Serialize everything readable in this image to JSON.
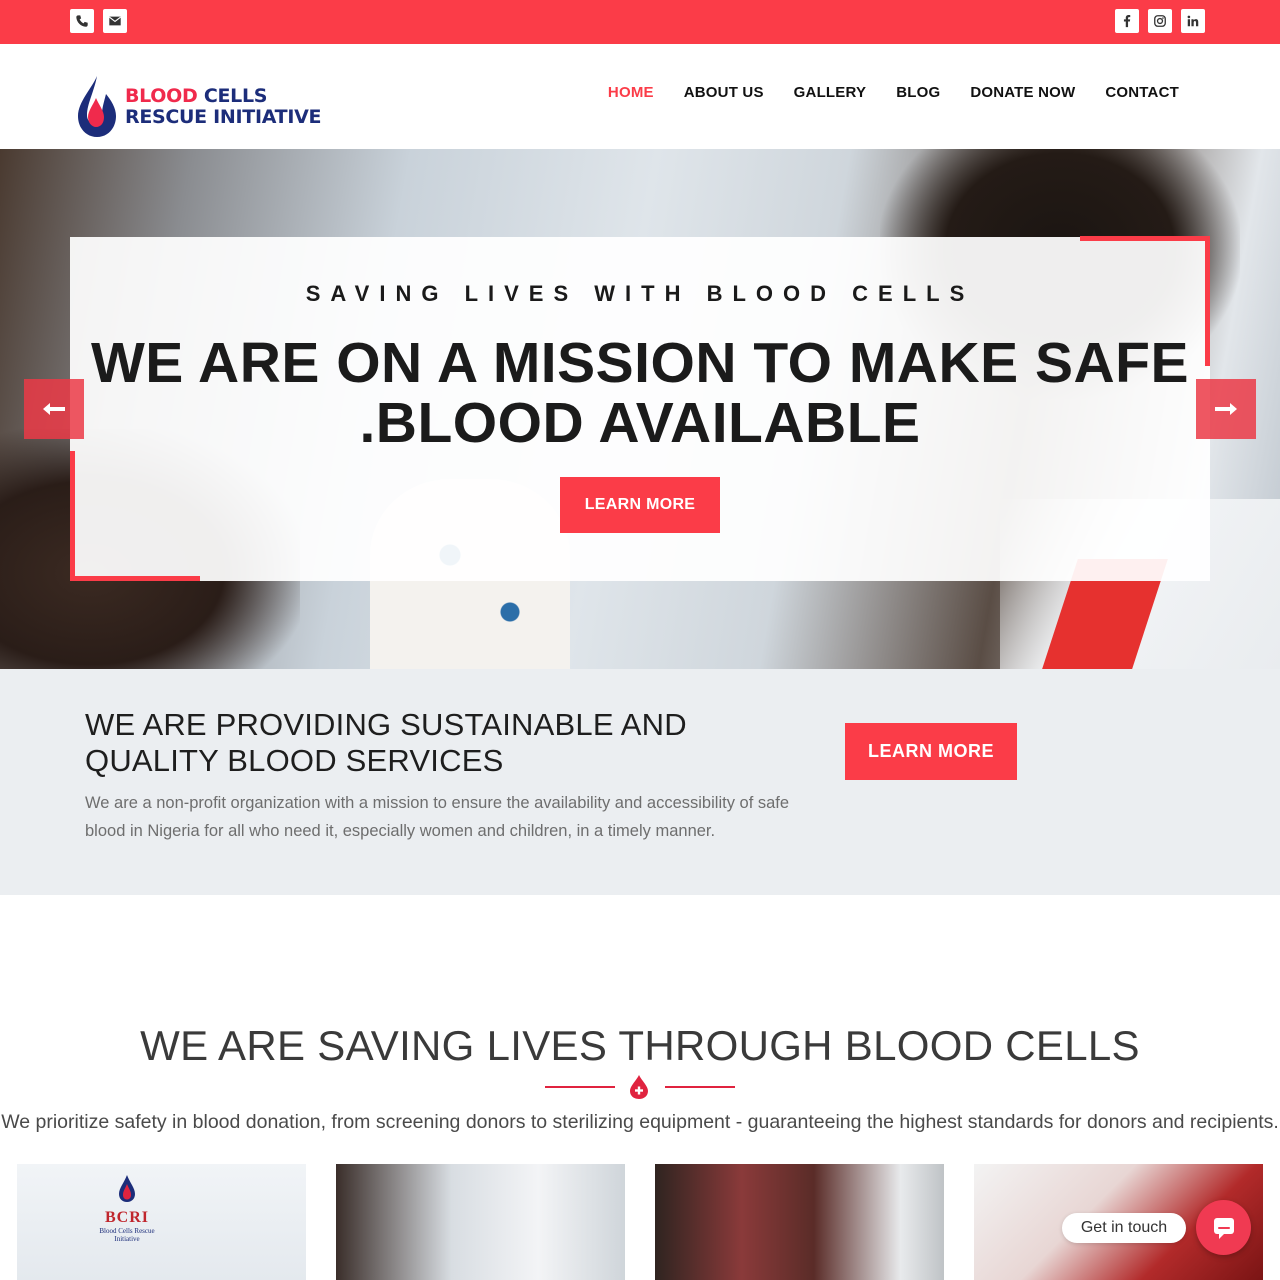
{
  "topbar": {
    "left_icons": [
      "phone-icon",
      "envelope-icon"
    ],
    "right_icons": [
      "facebook-icon",
      "instagram-icon",
      "linkedin-icon"
    ],
    "background": "#fb3c48"
  },
  "logo": {
    "line1_red": "BLOOD",
    "line1_blue": "CELLS",
    "line2": "RESCUE INITIATIVE"
  },
  "nav": {
    "items": [
      {
        "label": "HOME",
        "active": true
      },
      {
        "label": "ABOUT US",
        "active": false
      },
      {
        "label": "GALLERY",
        "active": false
      },
      {
        "label": "BLOG",
        "active": false
      },
      {
        "label": "DONATE NOW",
        "active": false
      },
      {
        "label": "CONTACT",
        "active": false
      }
    ]
  },
  "hero": {
    "kicker": "SAVING LIVES WITH BLOOD CELLS",
    "title": "WE ARE ON A MISSION TO MAKE SAFE .BLOOD AVAILABLE",
    "button": "LEARN MORE",
    "prev_icon": "arrow-left-icon",
    "next_icon": "arrow-right-icon"
  },
  "callout": {
    "title": "WE ARE PROVIDING SUSTAINABLE AND QUALITY BLOOD SERVICES",
    "text": "We are a non-profit organization with a mission to ensure the availability and accessibility of safe blood in Nigeria for all who need it, especially women and children, in a timely manner.",
    "button": "LEARN MORE"
  },
  "section": {
    "title": "WE ARE SAVING LIVES THROUGH BLOOD CELLS",
    "subtitle": "We prioritize safety in blood donation, from screening donors to sterilizing equipment - guaranteeing the highest standards for donors and recipients.",
    "divider_icon": "blood-drop-plus-icon"
  },
  "gallery": {
    "card1_logo": "BCRI",
    "card1_logo_sub": "Blood Cells Rescue Initiative"
  },
  "chat": {
    "label": "Get in touch",
    "icon": "chat-icon"
  },
  "colors": {
    "accent": "#fb3c48",
    "brand_blue": "#1c2d7a",
    "callout_bg": "#ebeef1"
  }
}
